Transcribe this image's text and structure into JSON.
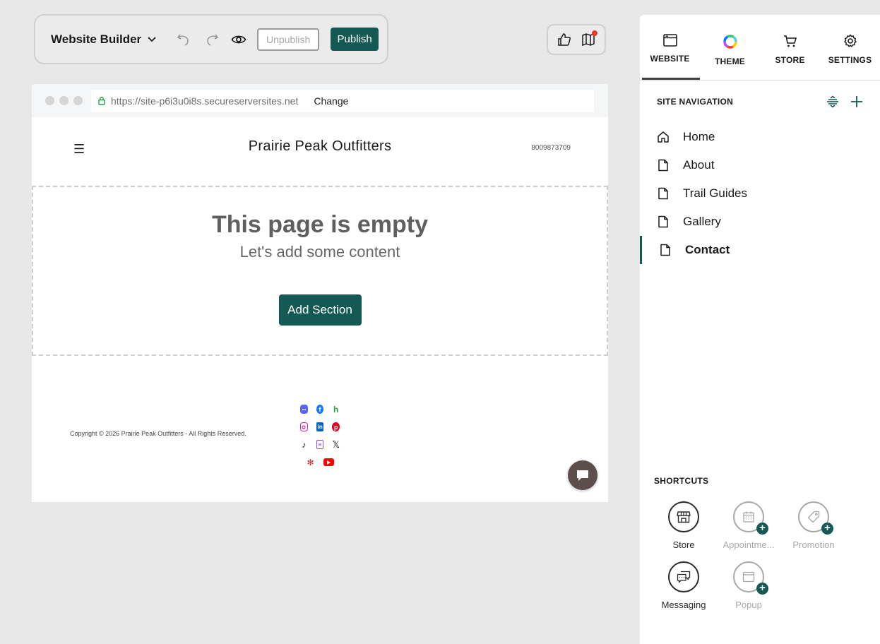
{
  "toolbar": {
    "title": "Website Builder",
    "unpublish_label": "Unpublish",
    "publish_label": "Publish"
  },
  "preview": {
    "url": "https://site-p6i3u0i8s.secureserversites.net",
    "change_label": "Change",
    "site_name": "Prairie Peak Outfitters",
    "phone": "8009873709",
    "empty_title": "This page is empty",
    "empty_subtitle": "Let's add some content",
    "add_section_label": "Add Section",
    "copyright": "Copyright © 2026 Prairie Peak Outfitters - All Rights Reserved."
  },
  "panel": {
    "tabs": [
      {
        "label": "WEBSITE",
        "icon": "browser-window-icon",
        "active": true
      },
      {
        "label": "THEME",
        "icon": "color-wheel-icon"
      },
      {
        "label": "STORE",
        "icon": "cart-icon"
      },
      {
        "label": "SETTINGS",
        "icon": "gear-icon"
      }
    ],
    "nav_title": "SITE NAVIGATION",
    "nav_items": [
      {
        "label": "Home",
        "icon": "home-icon"
      },
      {
        "label": "About",
        "icon": "page-icon"
      },
      {
        "label": "Trail Guides",
        "icon": "page-icon"
      },
      {
        "label": "Gallery",
        "icon": "page-icon"
      },
      {
        "label": "Contact",
        "icon": "page-icon",
        "active": true
      }
    ],
    "shortcuts_title": "SHORTCUTS",
    "shortcuts": [
      {
        "label": "Store",
        "icon": "storefront-icon",
        "enabled": true
      },
      {
        "label": "Appointme...",
        "icon": "calendar-icon",
        "enabled": false
      },
      {
        "label": "Promotion",
        "icon": "tag-icon",
        "enabled": false
      },
      {
        "label": "Messaging",
        "icon": "chat-icon",
        "enabled": true
      },
      {
        "label": "Popup",
        "icon": "popup-window-icon",
        "enabled": false
      }
    ]
  },
  "colors": {
    "brand": "#145953",
    "notification": "#e4392c"
  }
}
